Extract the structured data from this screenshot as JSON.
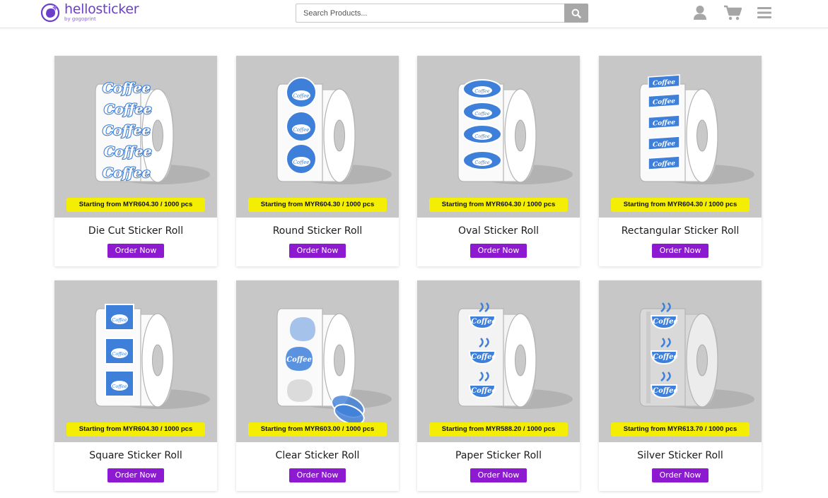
{
  "header": {
    "logo_main": "hellosticker",
    "logo_sub": "by gogoprint",
    "search_placeholder": "Search Products...",
    "icons": [
      "search-icon",
      "user-icon",
      "cart-icon",
      "menu-icon"
    ]
  },
  "colors": {
    "brand": "#6b3fc9",
    "order_button": "#8d1ad0",
    "price_tag": "#f4ee05",
    "card_image_bg": "#c7c7c7",
    "sticker_blue": "#3d7fd9"
  },
  "products": [
    {
      "name": "Die Cut Sticker Roll",
      "price": "Starting from MYR604.30 / 1000 pcs",
      "button": "Order Now"
    },
    {
      "name": "Round Sticker Roll",
      "price": "Starting from MYR604.30 / 1000 pcs",
      "button": "Order Now"
    },
    {
      "name": "Oval Sticker Roll",
      "price": "Starting from MYR604.30 / 1000 pcs",
      "button": "Order Now"
    },
    {
      "name": "Rectangular Sticker Roll",
      "price": "Starting from MYR604.30 / 1000 pcs",
      "button": "Order Now"
    },
    {
      "name": "Square Sticker Roll",
      "price": "Starting from MYR604.30 / 1000 pcs",
      "button": "Order Now"
    },
    {
      "name": "Clear Sticker Roll",
      "price": "Starting from MYR603.00 / 1000 pcs",
      "button": "Order Now"
    },
    {
      "name": "Paper Sticker Roll",
      "price": "Starting from MYR588.20 / 1000 pcs",
      "button": "Order Now"
    },
    {
      "name": "Silver Sticker Roll",
      "price": "Starting from MYR613.70 / 1000 pcs",
      "button": "Order Now"
    }
  ]
}
